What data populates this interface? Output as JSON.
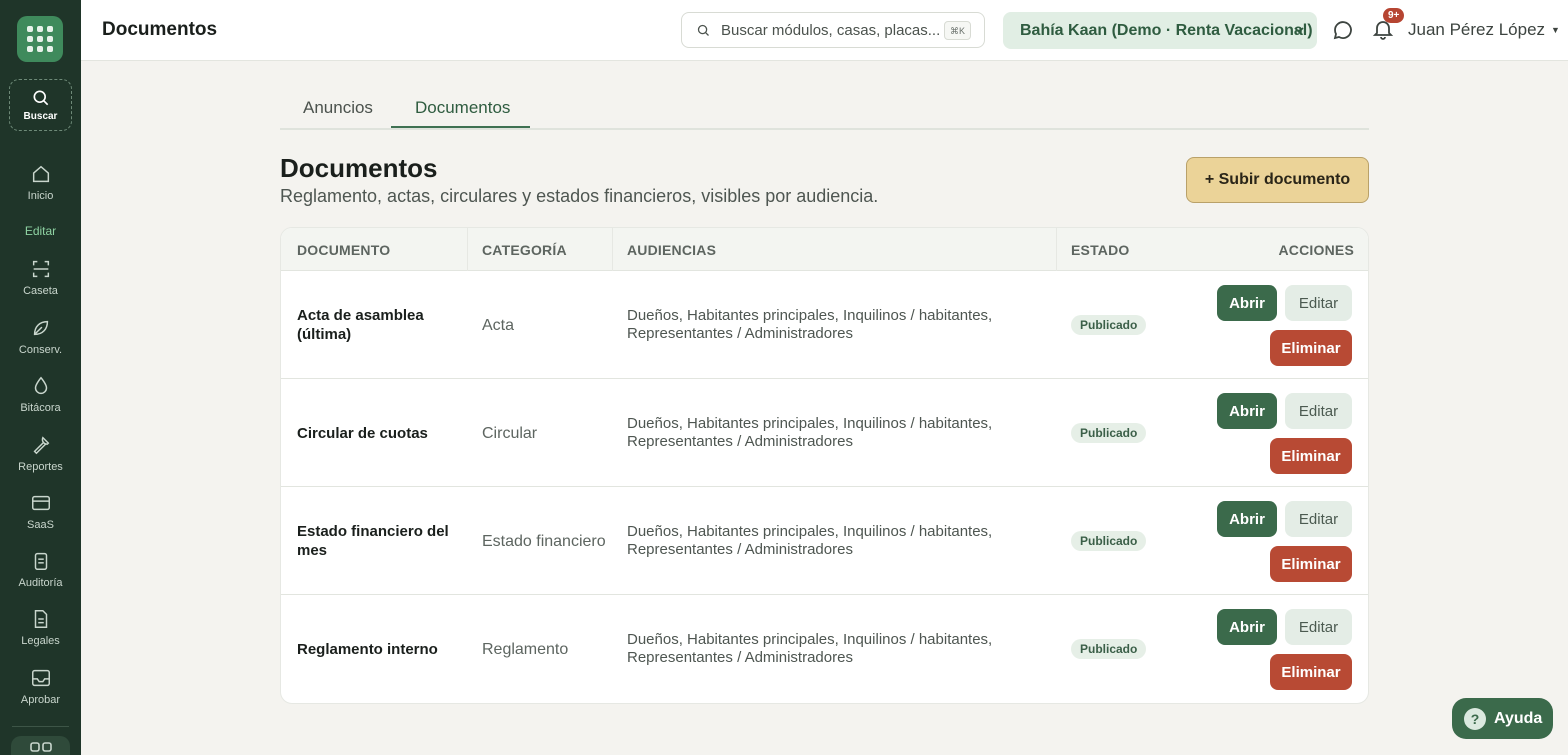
{
  "sidebar": {
    "search_label": "Buscar",
    "section_label": "Editar",
    "items": [
      {
        "label": "Inicio",
        "icon": "home-icon"
      },
      {
        "label": "Caseta",
        "icon": "scan-icon"
      },
      {
        "label": "Conserv.",
        "icon": "leaf-icon"
      },
      {
        "label": "Bitácora",
        "icon": "drop-icon"
      },
      {
        "label": "Reportes",
        "icon": "wrench-icon"
      },
      {
        "label": "SaaS",
        "icon": "card-icon"
      },
      {
        "label": "Auditoría",
        "icon": "clipboard-icon"
      },
      {
        "label": "Legales",
        "icon": "file-icon"
      },
      {
        "label": "Aprobar",
        "icon": "inbox-icon"
      }
    ]
  },
  "header": {
    "title": "Documentos",
    "search_placeholder": "Buscar módulos, casas, placas...",
    "search_shortcut": "⌘K",
    "org": "Bahía Kaan (Demo · Renta Vacacional)",
    "notifications_badge": "9+",
    "user": "Juan Pérez López"
  },
  "tabs": [
    {
      "label": "Anuncios",
      "active": false
    },
    {
      "label": "Documentos",
      "active": true
    }
  ],
  "section": {
    "title": "Documentos",
    "subtitle": "Reglamento, actas, circulares y estados financieros, visibles por audiencia.",
    "upload_label": "+ Subir documento"
  },
  "table": {
    "headers": {
      "document": "DOCUMENTO",
      "category": "CATEGORÍA",
      "audiences": "AUDIENCIAS",
      "status": "ESTADO",
      "actions": "ACCIONES"
    },
    "action_labels": {
      "open": "Abrir",
      "edit": "Editar",
      "delete": "Eliminar"
    },
    "rows": [
      {
        "document": "Acta de asamblea (última)",
        "category": "Acta",
        "audiences": "Dueños, Habitantes principales, Inquilinos / habitantes, Representantes / Administradores",
        "status": "Publicado"
      },
      {
        "document": "Circular de cuotas",
        "category": "Circular",
        "audiences": "Dueños, Habitantes principales, Inquilinos / habitantes, Representantes / Administradores",
        "status": "Publicado"
      },
      {
        "document": "Estado financiero del mes",
        "category": "Estado financiero",
        "audiences": "Dueños, Habitantes principales, Inquilinos / habitantes, Representantes / Administradores",
        "status": "Publicado"
      },
      {
        "document": "Reglamento interno",
        "category": "Reglamento",
        "audiences": "Dueños, Habitantes principales, Inquilinos / habitantes, Representantes / Administradores",
        "status": "Publicado"
      }
    ]
  },
  "help_label": "Ayuda",
  "colors": {
    "sidebar_bg": "#1f3529",
    "accent_green": "#3b6a4b",
    "danger": "#b84a34",
    "upload_bg": "#ebd398"
  }
}
